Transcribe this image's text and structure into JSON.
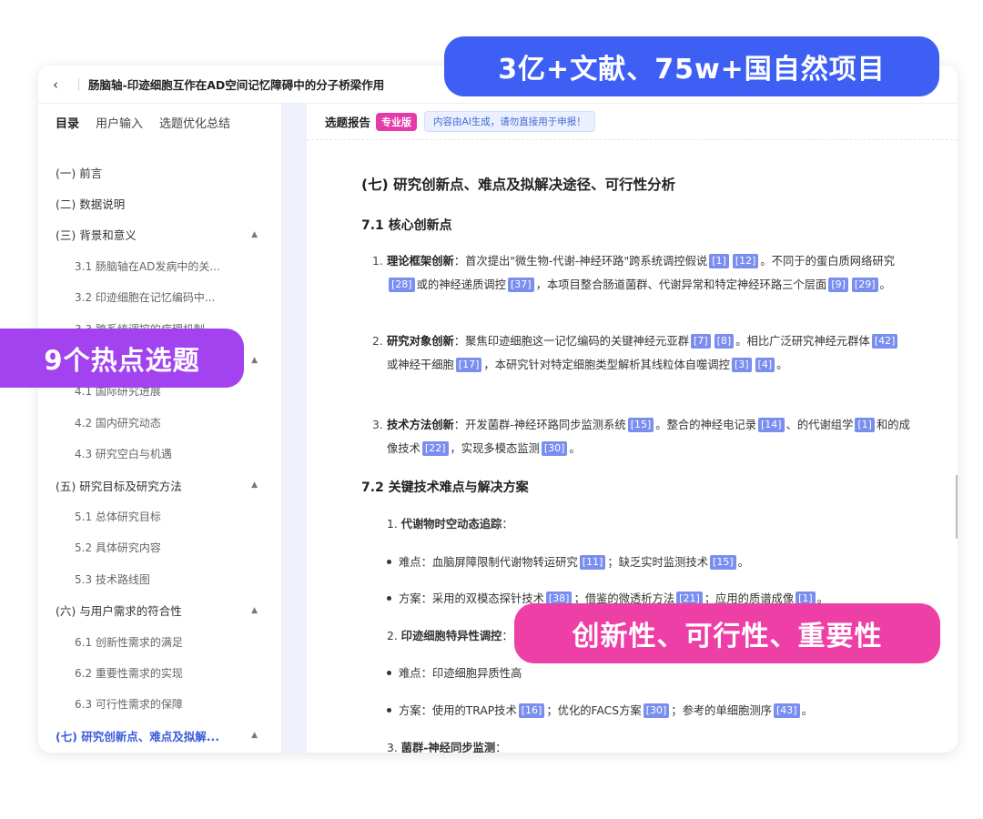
{
  "window": {
    "back_icon": "‹",
    "title": "肠脑轴-印迹细胞互作在AD空间记忆障碍中的分子桥梁作用"
  },
  "sidebar": {
    "tabs": [
      "目录",
      "用户输入",
      "选题优化总结"
    ],
    "toc": [
      {
        "label": "(一) 前言"
      },
      {
        "label": "(二) 数据说明"
      },
      {
        "label": "(三) 背景和意义",
        "caret": "▲"
      },
      {
        "label": "3.1 肠脑轴在AD发病中的关..."
      },
      {
        "label": "3.2 印迹细胞在记忆编码中..."
      },
      {
        "label": "3.3 跨系统调控的病理机制"
      },
      {
        "label": "",
        "caret": "▲"
      },
      {
        "label": "4.1 国际研究进展"
      },
      {
        "label": "4.2 国内研究动态"
      },
      {
        "label": "4.3 研究空白与机遇"
      },
      {
        "label": "(五) 研究目标及研究方法",
        "caret": "▲"
      },
      {
        "label": "5.1 总体研究目标"
      },
      {
        "label": "5.2 具体研究内容"
      },
      {
        "label": "5.3 技术路线图"
      },
      {
        "label": "(六) 与用户需求的符合性",
        "caret": "▲"
      },
      {
        "label": "6.1 创新性需求的满足"
      },
      {
        "label": "6.2 重要性需求的实现"
      },
      {
        "label": "6.3 可行性需求的保障"
      },
      {
        "label": "(七) 研究创新点、难点及拟解...",
        "caret": "▲"
      }
    ]
  },
  "main": {
    "report_label": "选题报告",
    "pro_badge": "专业版",
    "ai_note": "内容由AI生成，请勿直接用于申报！",
    "section_title": "(七) 研究创新点、难点及拟解决途径、可行性分析",
    "sub1": "7.1 核心创新点",
    "p1": {
      "num": "1.",
      "term": "理论框架创新",
      "seg1": "：首次提出\"微生物-代谢-神经环路\"跨系统调控假说",
      "r1": "[1]",
      "r2": "[12]",
      "seg2": "。不同于的蛋白质网络研究",
      "r3": "[28]",
      "seg3": "或的神经递质调控",
      "r4": "[37]",
      "seg4": "，本项目整合肠道菌群、代谢异常和特定神经环路三个层面",
      "r5": "[9]",
      "r6": "[29]",
      "seg5": "。"
    },
    "p2": {
      "num": "2.",
      "term": "研究对象创新",
      "seg1": "：聚焦印迹细胞这一记忆编码的关键神经元亚群",
      "r1": "[7]",
      "r2": "[8]",
      "seg2": "。相比广泛研究神经元群体",
      "r3": "[42]",
      "seg3": "或神经干细胞",
      "r4": "[17]",
      "seg4": "，本研究针对特定细胞类型解析其线粒体自噬调控",
      "r5": "[3]",
      "r6": "[4]",
      "seg5": "。"
    },
    "p3": {
      "num": "3.",
      "term": "技术方法创新",
      "seg1": "：开发菌群-神经环路同步监测系统",
      "r1": "[15]",
      "seg2": "。整合的神经电记录",
      "r2": "[14]",
      "seg3": "、的代谢组学",
      "r3": "[1]",
      "seg4": "和的成像技术",
      "r4": "[22]",
      "seg5": "，实现多模态监测",
      "r5": "[30]",
      "seg6": "。"
    },
    "sub2": "7.2 关键技术难点与解决方案",
    "n1": {
      "num": "1.",
      "term": "代谢物时空动态追踪",
      "colon": "："
    },
    "b1": {
      "label": "难点：血脑屏障限制代谢物转运研究",
      "r1": "[11]",
      "mid": "；缺乏实时监测技术",
      "r2": "[15]",
      "end": "。"
    },
    "b2": {
      "label": "方案：采用的双模态探针技术",
      "r1": "[38]",
      "mid": "；借鉴的微透析方法",
      "r2": "[21]",
      "mid2": "；应用的质谱成像",
      "r3": "[1]",
      "end": "。"
    },
    "n2": {
      "num": "2.",
      "term": "印迹细胞特异性调控",
      "colon": "："
    },
    "b3": {
      "label": "难点：印迹细胞异质性高"
    },
    "b4": {
      "label": "方案：使用的TRAP技术",
      "r1": "[16]",
      "mid": "；优化的FACS方案",
      "r2": "[30]",
      "mid2": "；参考的单细胞测序",
      "r3": "[43]",
      "end": "。"
    },
    "n3": {
      "num": "3.",
      "term": "菌群-神经同步监测",
      "colon": "："
    }
  },
  "banners": {
    "top": "3亿+文献、75w+国自然项目",
    "left": "9个热点选题",
    "right": "创新性、可行性、重要性"
  },
  "colors": {
    "accent_blue": "#3e5ff4",
    "accent_purple": "#a343f0",
    "accent_pink": "#ee3fa6",
    "ref_tag": "#7a8ef0",
    "active_toc": "#3b5bdb"
  }
}
